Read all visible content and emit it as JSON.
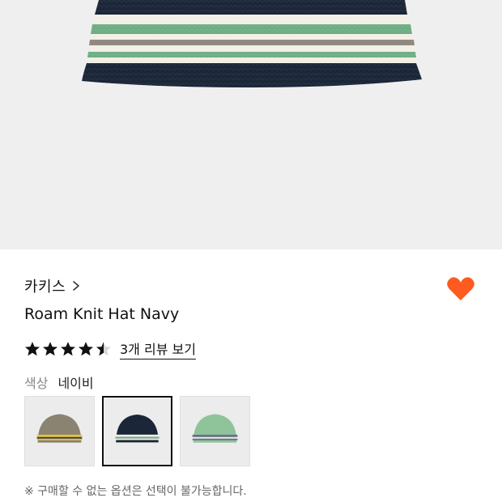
{
  "product": {
    "brand": "카키스",
    "title": "Roam Knit Hat Navy",
    "rating": 4.5,
    "rating_max": 5,
    "review_link": "3개 리뷰 보기",
    "liked": true
  },
  "options": {
    "color_label": "색상",
    "color_value": "네이비",
    "swatches": [
      {
        "name": "khaki",
        "base": "#8a8372",
        "stripe1": "#e8c340",
        "stripe2": "#2d3b52",
        "selected": false
      },
      {
        "name": "navy",
        "base": "#1b2638",
        "stripe1": "#f1efe6",
        "stripe2": "#6fae85",
        "selected": true
      },
      {
        "name": "green",
        "base": "#8fc49a",
        "stripe1": "#6b6f8a",
        "stripe2": "#f1efe6",
        "selected": false
      }
    ],
    "notice": "※ 구매할 수 없는 옵션은 선택이 불가능합니다."
  },
  "colors": {
    "accent_heart": "#ff5a1f",
    "hat_navy": "#1b2638",
    "stripe_green": "#6fae85",
    "stripe_cream": "#f1efe6",
    "stripe_gray": "#8f8880"
  },
  "icons": {
    "brand_chevron": "chevron-right-icon",
    "like": "heart-icon",
    "star": "star-icon"
  }
}
